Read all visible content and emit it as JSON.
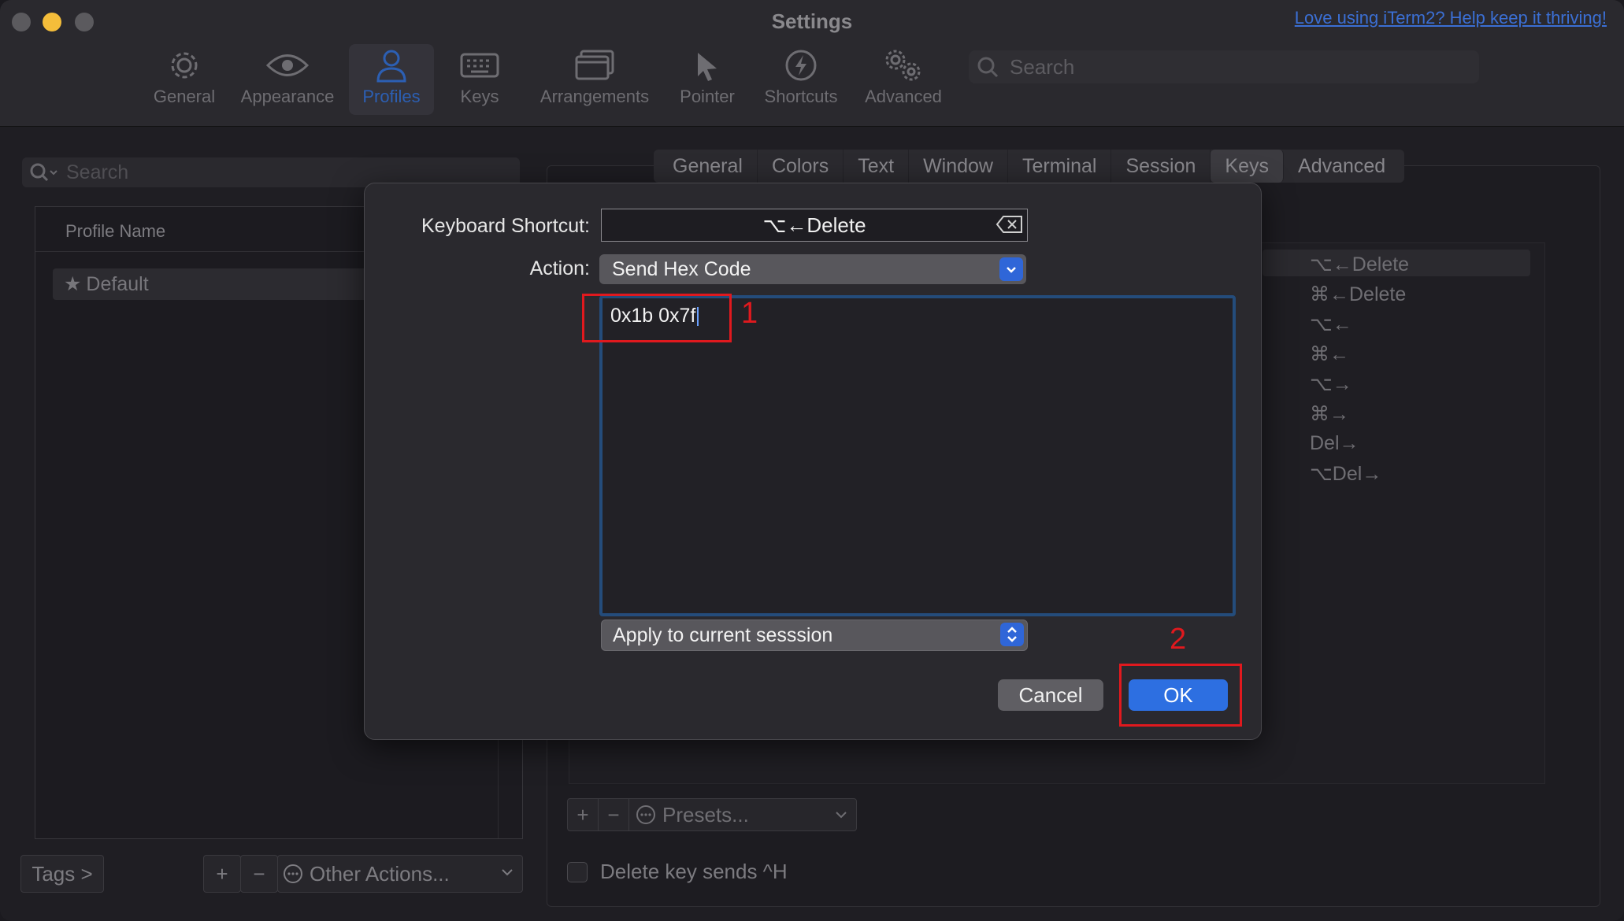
{
  "window": {
    "title": "Settings",
    "promo_link": "Love using iTerm2? Help keep it thriving!"
  },
  "toolbar": {
    "items": [
      {
        "label": "General",
        "icon": "gear-icon"
      },
      {
        "label": "Appearance",
        "icon": "eye-icon"
      },
      {
        "label": "Profiles",
        "icon": "person-icon",
        "active": true
      },
      {
        "label": "Keys",
        "icon": "keyboard-icon"
      },
      {
        "label": "Arrangements",
        "icon": "window-icon"
      },
      {
        "label": "Pointer",
        "icon": "pointer-icon"
      },
      {
        "label": "Shortcuts",
        "icon": "bolt-icon"
      },
      {
        "label": "Advanced",
        "icon": "gears-icon"
      }
    ],
    "search_placeholder": "Search"
  },
  "profiles": {
    "search_placeholder": "Search",
    "header": "Profile Name",
    "rows": [
      {
        "name": "Default",
        "star": "★"
      }
    ],
    "tags_button": "Tags >",
    "add_symbol": "+",
    "remove_symbol": "−",
    "other_actions": "Other Actions..."
  },
  "profile_tabs": [
    "General",
    "Colors",
    "Text",
    "Window",
    "Terminal",
    "Session",
    "Keys",
    "Advanced"
  ],
  "active_tab": "Keys",
  "key_mappings": [
    "⌥←Delete",
    "⌘←Delete",
    "⌥←",
    "⌘←",
    "⌥→",
    "⌘→",
    "Del→",
    "⌥Del→"
  ],
  "key_bottom": {
    "add_symbol": "+",
    "remove_symbol": "−",
    "presets": "Presets...",
    "delete_sends_label": "Delete key sends ^H",
    "delete_sends_checked": false
  },
  "dialog": {
    "shortcut_label": "Keyboard Shortcut:",
    "shortcut_value": "⌥←Delete",
    "action_label": "Action:",
    "action_value": "Send Hex Code",
    "hex_value": "0x1b 0x7f",
    "apply_value": "Apply to current sesssion",
    "cancel_label": "Cancel",
    "ok_label": "OK"
  },
  "annotations": {
    "step1": "1",
    "step2": "2",
    "color": "#e0191e"
  },
  "colors": {
    "accent": "#2d6fe1",
    "active_tab_icon": "#2c5fb3"
  }
}
